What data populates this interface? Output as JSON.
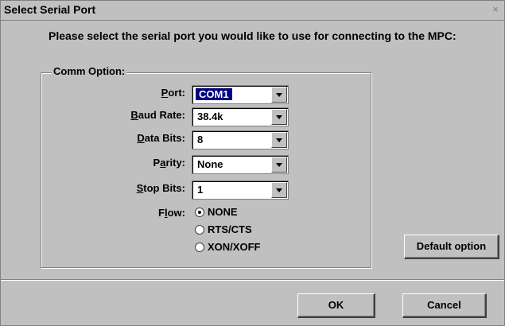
{
  "window": {
    "title": "Select Serial Port",
    "close_glyph": "×"
  },
  "prompt": "Please select the serial port you would like to use for connecting to the MPC:",
  "group": {
    "label": "Comm Option:"
  },
  "fields": {
    "port": {
      "label_pre": "",
      "label_mn": "P",
      "label_post": "ort:",
      "value": "COM1"
    },
    "baud": {
      "label_pre": "",
      "label_mn": "B",
      "label_post": "aud Rate:",
      "value": "38.4k"
    },
    "data": {
      "label_pre": "",
      "label_mn": "D",
      "label_post": "ata Bits:",
      "value": "8"
    },
    "parity": {
      "label_pre": "P",
      "label_mn": "a",
      "label_post": "rity:",
      "value": "None"
    },
    "stop": {
      "label_pre": "",
      "label_mn": "S",
      "label_post": "top Bits:",
      "value": "1"
    }
  },
  "flow": {
    "label_pre": "F",
    "label_mn": "l",
    "label_post": "ow:",
    "options": [
      "NONE",
      "RTS/CTS",
      "XON/XOFF"
    ]
  },
  "buttons": {
    "default_option": "Default option",
    "ok": "OK",
    "cancel": "Cancel"
  }
}
